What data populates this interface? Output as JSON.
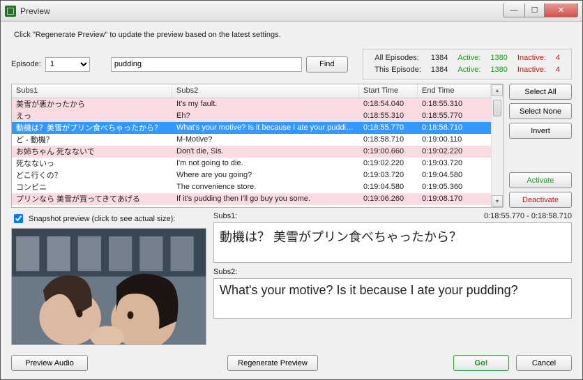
{
  "window": {
    "title": "Preview"
  },
  "hint": "Click \"Regenerate Preview\" to update the preview based on the latest settings.",
  "episode": {
    "label": "Episode:",
    "selected": "1"
  },
  "search": {
    "value": "pudding",
    "find_label": "Find"
  },
  "stats": {
    "all_label": "All Episodes:",
    "all_total": "1384",
    "all_active_label": "Active:",
    "all_active": "1380",
    "all_inactive_label": "Inactive:",
    "all_inactive": "4",
    "this_label": "This Episode:",
    "this_total": "1384",
    "this_active_label": "Active:",
    "this_active": "1380",
    "this_inactive_label": "Inactive:",
    "this_inactive": "4"
  },
  "columns": {
    "s1": "Subs1",
    "s2": "Subs2",
    "st": "Start Time",
    "et": "End Time"
  },
  "rows": [
    {
      "s1": "美雪が悪かったから",
      "s2": "It's my fault.",
      "st": "0:18:54.040",
      "et": "0:18:55.310",
      "active": true
    },
    {
      "s1": "えっ",
      "s2": "Eh?",
      "st": "0:18:55.310",
      "et": "0:18:55.770",
      "active": true
    },
    {
      "s1": "動機は？美雪がプリン食べちゃったから？",
      "s2": "What's your motive? Is it because I ate your pudding?",
      "st": "0:18:55.770",
      "et": "0:18:58.710",
      "active": true,
      "selected": true
    },
    {
      "s1": "ど - 動機？",
      "s2": "M-Motive?",
      "st": "0:18:58.710",
      "et": "0:19:00.110",
      "active": false
    },
    {
      "s1": "お姉ちゃん 死なないで",
      "s2": "Don't die, Sis.",
      "st": "0:19:00.660",
      "et": "0:19:02.220",
      "active": true
    },
    {
      "s1": "死なないっ",
      "s2": "I'm not going to die.",
      "st": "0:19:02.220",
      "et": "0:19:03.720",
      "active": false
    },
    {
      "s1": "どこ行くの？",
      "s2": "Where are you going?",
      "st": "0:19:03.720",
      "et": "0:19:04.580",
      "active": false
    },
    {
      "s1": "コンビニ",
      "s2": "The convenience store.",
      "st": "0:19:04.580",
      "et": "0:19:05.360",
      "active": false
    },
    {
      "s1": "プリンなら 美雪が買ってきてあげる",
      "s2": "If it's pudding then I'll go buy you some.",
      "st": "0:19:06.260",
      "et": "0:19:08.170",
      "active": true
    }
  ],
  "sidebuttons": {
    "select_all": "Select All",
    "select_none": "Select None",
    "invert": "Invert",
    "activate": "Activate",
    "deactivate": "Deactivate"
  },
  "snapshot": {
    "chk_label": "Snapshot preview (click to see actual size):"
  },
  "detail": {
    "subs1_label": "Subs1:",
    "time_range": "0:18:55.770 - 0:18:58.710",
    "subs1_text": "動機は？ 美雪がプリン食べちゃったから？",
    "subs2_label": "Subs2:",
    "subs2_text": "What's your motive? Is it because I ate your pudding?"
  },
  "footer": {
    "preview_audio": "Preview Audio",
    "regenerate": "Regenerate Preview",
    "go": "Go!",
    "cancel": "Cancel"
  }
}
